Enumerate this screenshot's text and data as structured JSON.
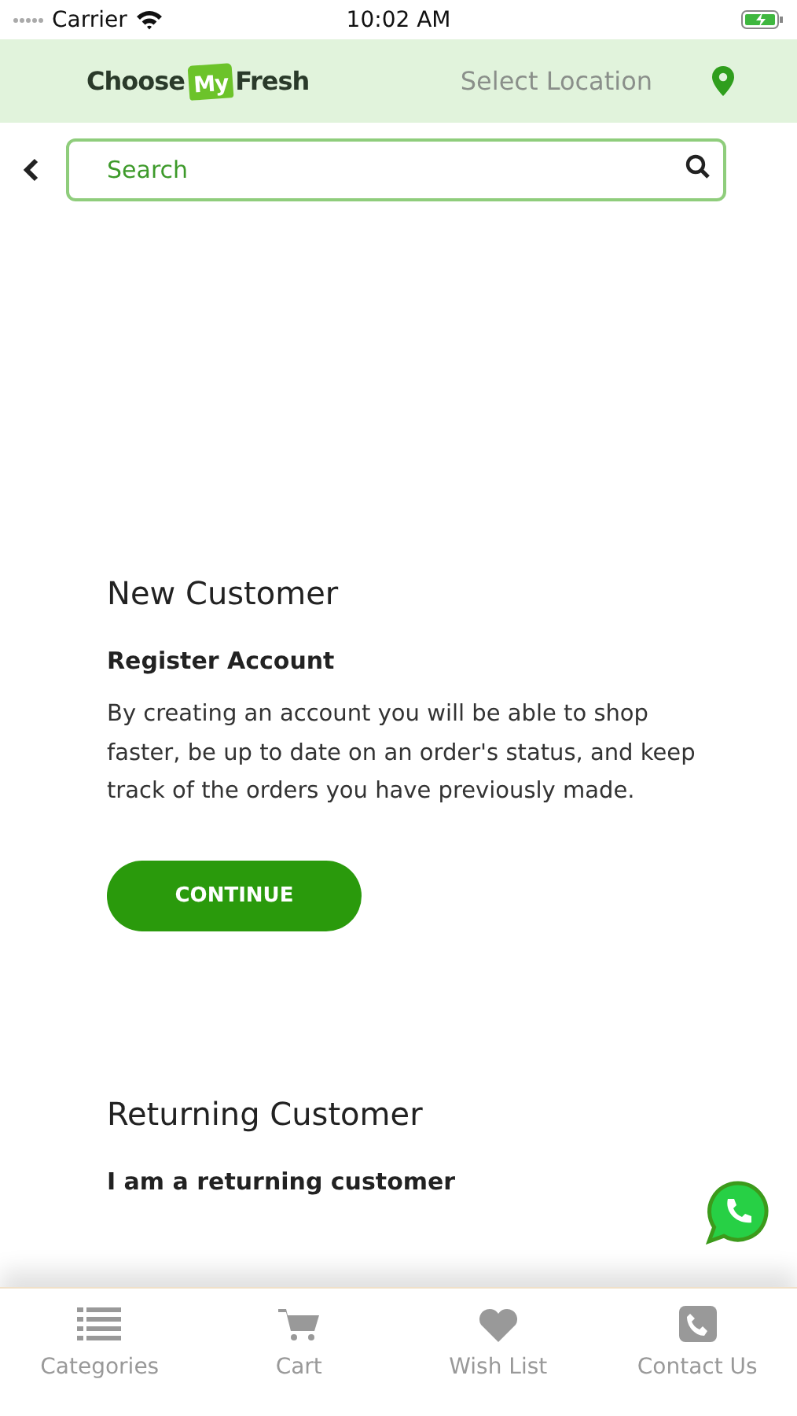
{
  "status_bar": {
    "carrier": "Carrier",
    "time": "10:02 AM"
  },
  "header": {
    "logo": [
      "Choose",
      "My",
      "Fresh"
    ],
    "location": "Select Location"
  },
  "search": {
    "placeholder": "Search"
  },
  "new_customer": {
    "title": "New Customer",
    "subtitle": "Register Account",
    "text": "By creating an account you will be able to shop faster, be up to date on an order's status, and keep track of the orders you have previously made.",
    "button": "CONTINUE"
  },
  "returning_customer": {
    "title": "Returning Customer",
    "subtitle": "I am a returning customer"
  },
  "tab_bar": [
    {
      "kind": "list",
      "label": "Categories"
    },
    {
      "kind": "cart",
      "label": "Cart"
    },
    {
      "kind": "heart",
      "label": "Wish List"
    },
    {
      "kind": "phone",
      "label": "Contact Us"
    }
  ]
}
